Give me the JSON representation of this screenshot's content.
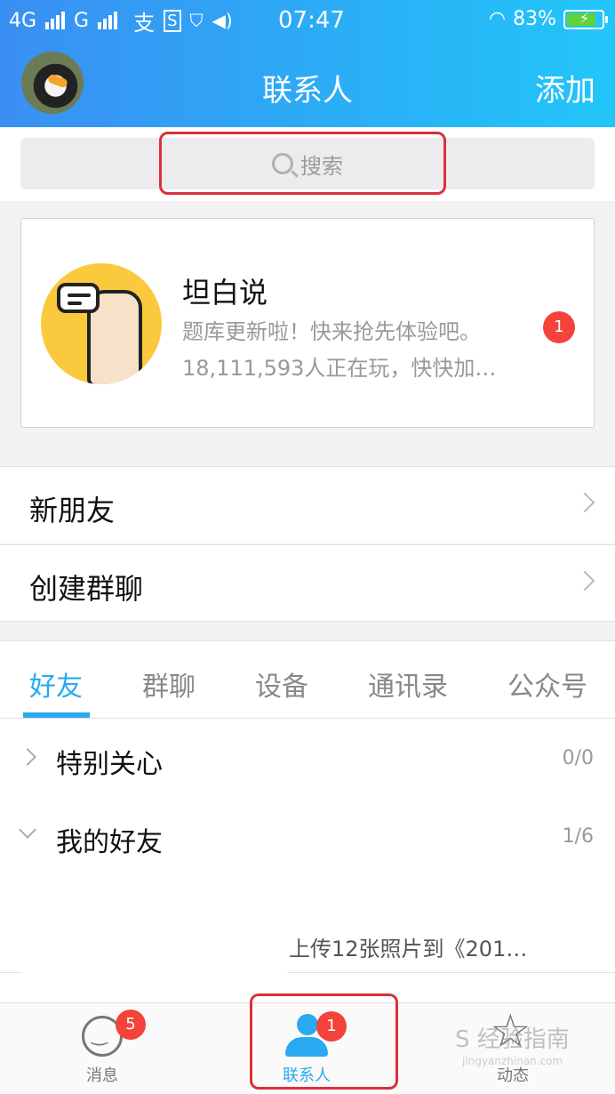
{
  "statusbar": {
    "network1": "4G",
    "network2": "G",
    "time": "07:47",
    "battery": "83%",
    "battery_level": 0.83
  },
  "header": {
    "title": "联系人",
    "add_label": "添加"
  },
  "search": {
    "placeholder": "搜索"
  },
  "card": {
    "title": "坦白说",
    "line1": "题库更新啦！快来抢先体验吧。",
    "line2": "18,111,593人正在玩，快快加…",
    "badge": "1"
  },
  "rows": {
    "new_friends": "新朋友",
    "create_group": "创建群聊"
  },
  "tabs": [
    {
      "label": "好友"
    },
    {
      "label": "群聊"
    },
    {
      "label": "设备"
    },
    {
      "label": "通讯录"
    },
    {
      "label": "公众号"
    }
  ],
  "groups": [
    {
      "label": "特别关心",
      "count": "0/0"
    },
    {
      "label": "我的好友",
      "count": "1/6"
    }
  ],
  "peek_text": "上传12张照片到《201…",
  "bottom_nav": {
    "messages": {
      "label": "消息",
      "badge": "5"
    },
    "contacts": {
      "label": "联系人",
      "badge": "1"
    },
    "moments": {
      "label": "动态"
    }
  },
  "watermark": "S 经验指南",
  "watermark_url": "jingyanzhinan.com",
  "colors": {
    "accent": "#2aa8f0",
    "badge": "#f4433a",
    "highlight": "#d9313a"
  }
}
